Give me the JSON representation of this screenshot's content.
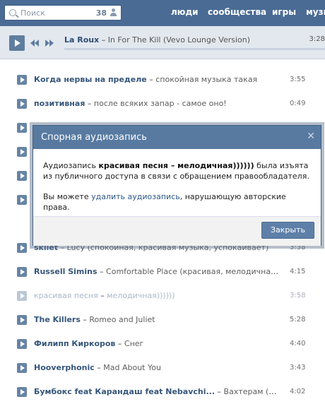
{
  "search": {
    "placeholder": "Поиск",
    "count": "38"
  },
  "nav": [
    "люди",
    "сообщества",
    "игры",
    "музы"
  ],
  "player": {
    "artist": "La Roux",
    "sep": " – ",
    "title": "In For The Kill (Vevo Lounge Version)",
    "time": "3:28"
  },
  "tracks": [
    {
      "artist": "Когда нервы на пределе",
      "title": "спокойная музыка такая",
      "time": "3:55"
    },
    {
      "artist": "позитивная",
      "title": "после всяких запар - самое оно!",
      "time": "0:49"
    },
    {
      "artist": "skilet",
      "title": "Lucy (спокойная, красивая музыка, успокаивает)",
      "time": "3:38"
    },
    {
      "artist": "Russell Simins",
      "title": "Comfortable Place (красивая, мелодичная ко...",
      "time": "4:15"
    },
    {
      "artist": "красивая песня",
      "title": "мелодичная))))))",
      "time": "3:58"
    },
    {
      "artist": "The Killers",
      "title": "Romeo and Juliet",
      "time": "5:28"
    },
    {
      "artist": "Филипп Киркоров",
      "title": "Снег",
      "time": "4:40"
    },
    {
      "artist": "Hooverphonic",
      "title": "Mad About You",
      "time": "3:43"
    },
    {
      "artist": "Бумбокс feat Карандаш feat Nebavchi...",
      "title": "Вахтерам (201...",
      "time": "4:02"
    }
  ],
  "dialog": {
    "title": "Спорная аудиозапись",
    "close": "✕",
    "p1_prefix": "Аудиозапись ",
    "p1_bold": "красивая песня – мелодичная))))))",
    "p1_suffix": " была изъята из публичного доступа в связи с обращением правообладателя.",
    "p2_prefix": "Вы можете ",
    "p2_link": "удалить аудиозапись",
    "p2_suffix": ", нарушающую авторские права.",
    "button": "Закрыть"
  }
}
